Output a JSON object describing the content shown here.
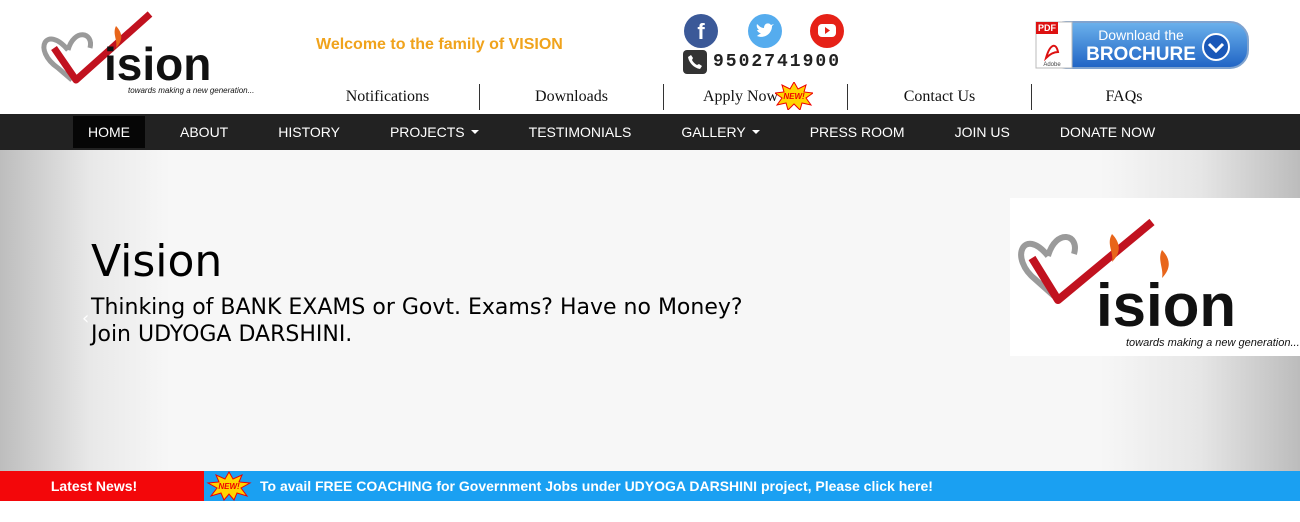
{
  "header": {
    "logo_text": "VISION",
    "logo_tagline": "towards making a new generation...",
    "welcome": "Welcome to the family of VISION",
    "phone": "9502741900",
    "brochure": {
      "line1": "Download the",
      "line2": "BROCHURE",
      "pdf_label": "PDF",
      "adobe_label": "Adobe"
    },
    "social": {
      "facebook_color": "#3b5998",
      "twitter_color": "#55acee",
      "youtube_color": "#e62117"
    },
    "links": [
      {
        "label": "Notifications"
      },
      {
        "label": "Downloads"
      },
      {
        "label": "Apply Now",
        "badge": "NEW!"
      },
      {
        "label": "Contact Us"
      },
      {
        "label": "FAQs"
      }
    ]
  },
  "nav": {
    "items": [
      {
        "label": "HOME",
        "active": true
      },
      {
        "label": "ABOUT"
      },
      {
        "label": "HISTORY"
      },
      {
        "label": "PROJECTS",
        "dropdown": true
      },
      {
        "label": "TESTIMONIALS"
      },
      {
        "label": "GALLERY",
        "dropdown": true
      },
      {
        "label": "PRESS ROOM"
      },
      {
        "label": "JOIN US"
      },
      {
        "label": "DONATE NOW"
      }
    ]
  },
  "hero": {
    "title": "Vision",
    "line1": "Thinking of BANK EXAMS or Govt. Exams? Have no Money?",
    "line2": "Join UDYOGA DARSHINI.",
    "prev_glyph": "‹",
    "logo_text": "VISION",
    "logo_tagline": "towards making a new generation..."
  },
  "ticker": {
    "label": "Latest News!",
    "badge": "NEW!",
    "text": "To avail FREE COACHING for Government Jobs under UDYOGA DARSHINI project, Please click here!"
  },
  "colors": {
    "accent_orange": "#f0a31c",
    "nav_bg": "#222222",
    "ticker_red": "#f3070a",
    "ticker_blue": "#1aa0f2"
  }
}
